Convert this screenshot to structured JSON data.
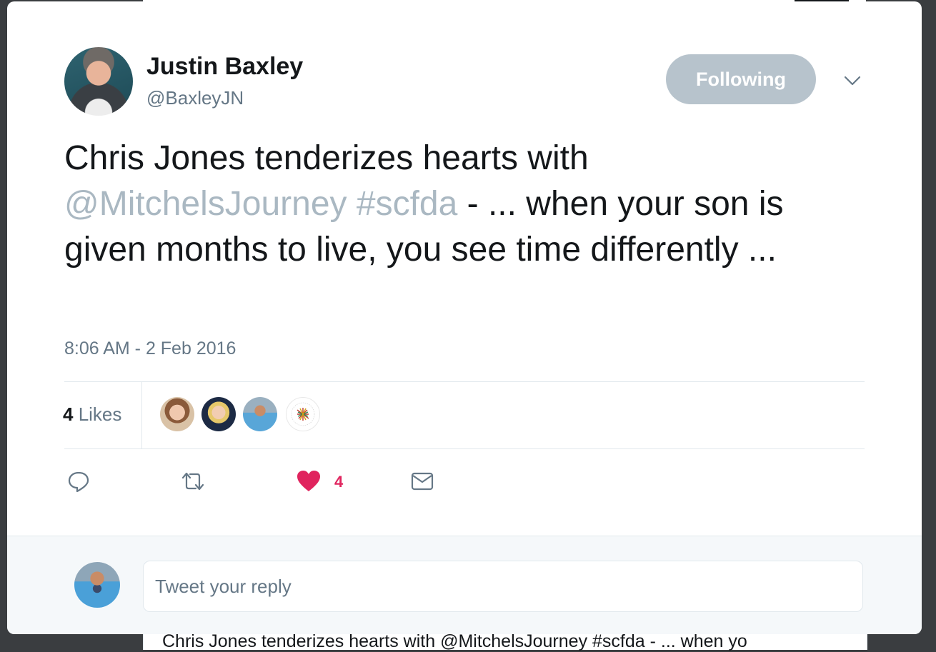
{
  "author": {
    "name": "Justin Baxley",
    "handle": "@BaxleyJN",
    "follow_label": "Following"
  },
  "tweet": {
    "text_before": "Chris Jones tenderizes hearts with ",
    "mention": "@MitchelsJourney",
    "space": " ",
    "hashtag": "#scfda",
    "text_after": " - ... when your son is given months to live, you see time differently ...",
    "timestamp": "8:06 AM - 2 Feb 2016"
  },
  "stats": {
    "likes_count": "4",
    "likes_label": " Likes",
    "likers": [
      "liker-avatar-1",
      "liker-avatar-2",
      "liker-avatar-3",
      "foundation-partners-logo"
    ]
  },
  "actions": {
    "like_count": "4",
    "icons": [
      "reply-icon",
      "retweet-icon",
      "heart-icon",
      "envelope-icon"
    ]
  },
  "reply": {
    "placeholder": "Tweet your reply"
  },
  "background": {
    "text": "Chris Jones tenderizes hearts with @MitchelsJourney #scfda - ... when yo"
  },
  "colors": {
    "follow_button": "#b7c3cc",
    "link": "#aab8c2",
    "like": "#e0245e",
    "muted_text": "#657786"
  }
}
